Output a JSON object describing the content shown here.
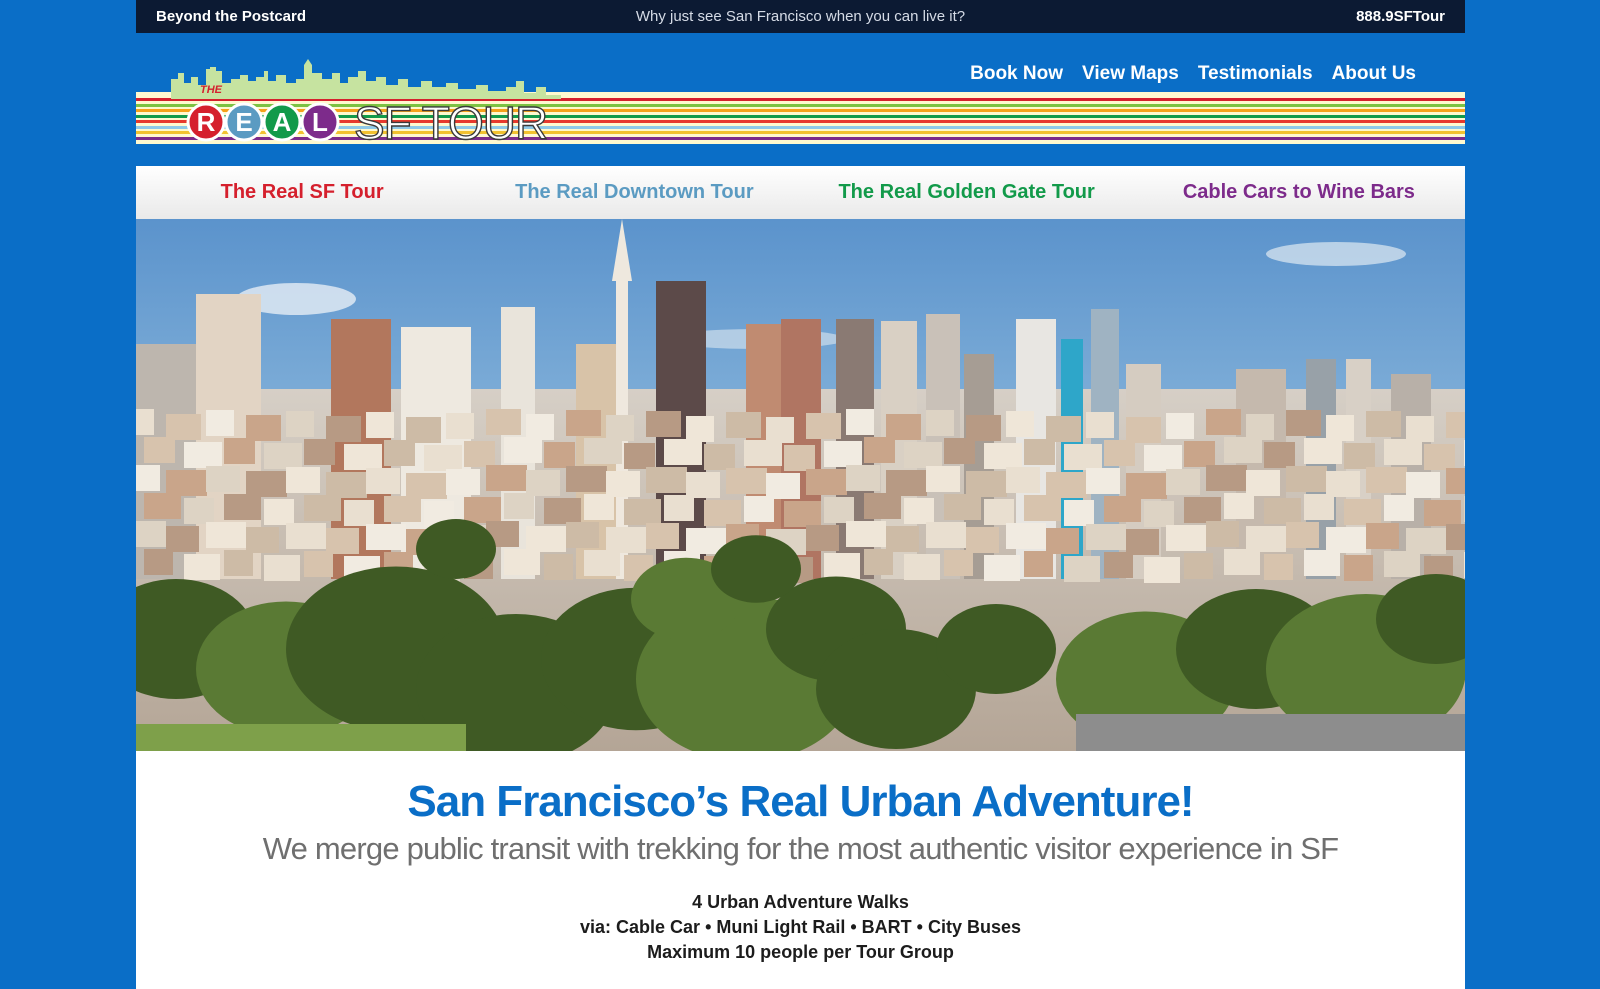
{
  "topbar": {
    "left_text": "Beyond the Postcard",
    "center_text": "Why just see San Francisco when you can live it?",
    "phone": "888.9SFTour"
  },
  "logo": {
    "the": "THE",
    "letters": [
      "R",
      "E",
      "A",
      "L"
    ],
    "letter_colors": [
      "#d5202d",
      "#5b9bc2",
      "#129a4a",
      "#7d2b8b"
    ],
    "rest": "SF TOUR"
  },
  "main_nav": [
    {
      "label": "Book Now"
    },
    {
      "label": "View Maps"
    },
    {
      "label": "Testimonials"
    },
    {
      "label": "About Us"
    }
  ],
  "tour_nav": [
    {
      "label": "The Real SF Tour",
      "color": "#d5202d"
    },
    {
      "label": "The Real Downtown Tour",
      "color": "#5b9bc2"
    },
    {
      "label": "The Real Golden Gate Tour",
      "color": "#129a4a"
    },
    {
      "label": "Cable Cars to Wine Bars",
      "color": "#7d2b8b"
    }
  ],
  "content": {
    "headline": "San Francisco’s Real Urban Adventure!",
    "subhead": "We merge public transit with trekking for the most authentic visitor experience in SF",
    "lines": [
      "4 Urban Adventure Walks",
      "via: Cable Car • Muni Light Rail • BART • City Buses",
      "Maximum 10 people per Tour Group"
    ]
  },
  "colors": {
    "page_bg": "#0a6ec7",
    "topbar_bg": "#0c1a33",
    "headline": "#0a6ec7",
    "stripes": [
      "#d5202d",
      "#7dc243",
      "#f6a21b",
      "#129a4a",
      "#e6392d",
      "#8fc9e8",
      "#f2c230",
      "#7d2b8b"
    ]
  }
}
